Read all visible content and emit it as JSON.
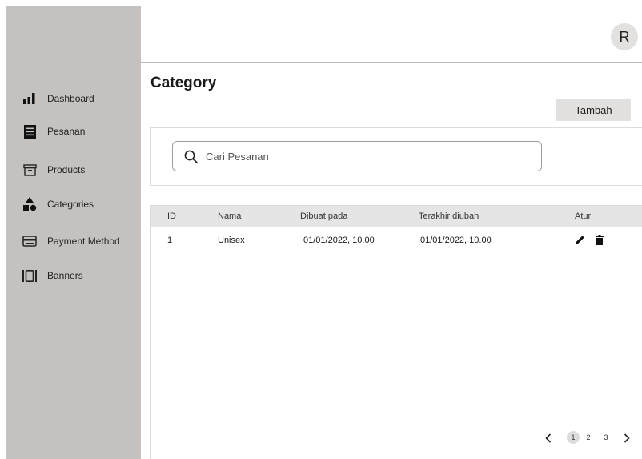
{
  "sidebar": {
    "items": [
      {
        "label": "Dashboard",
        "icon": "bar-chart-icon"
      },
      {
        "label": "Pesanan",
        "icon": "list-icon"
      },
      {
        "label": "Products",
        "icon": "archive-box-icon"
      },
      {
        "label": "Categories",
        "icon": "shapes-icon"
      },
      {
        "label": "Payment Method",
        "icon": "credit-card-icon"
      },
      {
        "label": "Banners",
        "icon": "carousel-icon"
      }
    ]
  },
  "header": {
    "avatar_initial": "R"
  },
  "page": {
    "title": "Category",
    "add_label": "Tambah"
  },
  "search": {
    "placeholder": "Cari Pesanan",
    "value": ""
  },
  "table": {
    "columns": [
      "ID",
      "Nama",
      "Dibuat pada",
      "Terakhir diubah",
      "Atur"
    ],
    "rows": [
      {
        "id": "1",
        "nama": "Unisex",
        "dibuat": "01/01/2022, 10.00",
        "diubah": "01/01/2022, 10.00"
      }
    ]
  },
  "pagination": {
    "pages": [
      "1",
      "2",
      "3"
    ],
    "current": "1"
  },
  "colors": {
    "sidebar": "#c5c1be",
    "button": "#e3e1df",
    "table_header": "#e5e5e5"
  }
}
